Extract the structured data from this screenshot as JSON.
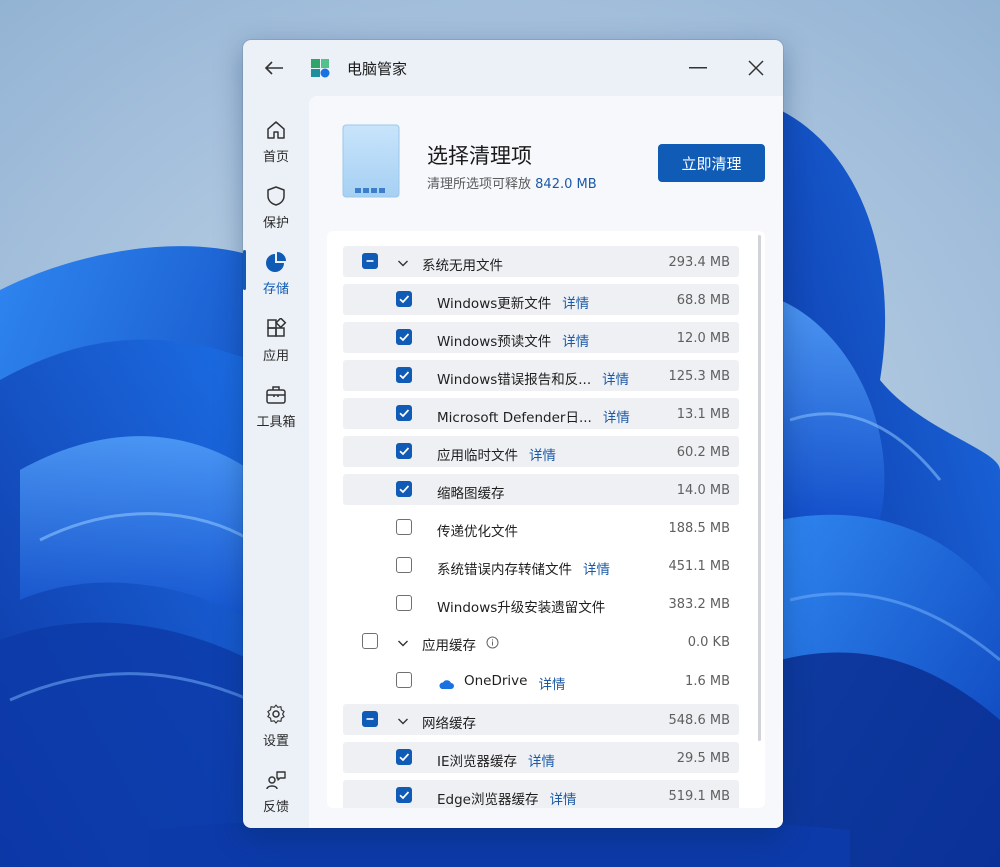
{
  "app": {
    "title": "电脑管家"
  },
  "sidebar": {
    "items": [
      {
        "label": "首页",
        "icon": "home-icon"
      },
      {
        "label": "保护",
        "icon": "shield-icon"
      },
      {
        "label": "存储",
        "icon": "pie-chart-icon",
        "active": true
      },
      {
        "label": "应用",
        "icon": "apps-icon"
      },
      {
        "label": "工具箱",
        "icon": "toolbox-icon"
      }
    ],
    "bottom": [
      {
        "label": "设置",
        "icon": "gear-icon"
      },
      {
        "label": "反馈",
        "icon": "feedback-icon"
      }
    ]
  },
  "header": {
    "title": "选择清理项",
    "subtitle_prefix": "清理所选项可释放",
    "amount": "842.0 MB",
    "clean_button": "立即清理"
  },
  "detail_label": "详情",
  "groups": [
    {
      "name": "系统无用文件",
      "size": "293.4 MB",
      "state": "partial",
      "items": [
        {
          "name": "Windows更新文件",
          "size": "68.8 MB",
          "checked": true,
          "detail": true
        },
        {
          "name": "Windows预读文件",
          "size": "12.0 MB",
          "checked": true,
          "detail": true
        },
        {
          "name": "Windows错误报告和反...",
          "size": "125.3 MB",
          "checked": true,
          "detail": true
        },
        {
          "name": "Microsoft Defender日...",
          "size": "13.1 MB",
          "checked": true,
          "detail": true
        },
        {
          "name": "应用临时文件",
          "size": "60.2 MB",
          "checked": true,
          "detail": true
        },
        {
          "name": "缩略图缓存",
          "size": "14.0 MB",
          "checked": true,
          "detail": false
        },
        {
          "name": "传递优化文件",
          "size": "188.5 MB",
          "checked": false,
          "detail": false
        },
        {
          "name": "系统错误内存转储文件",
          "size": "451.1 MB",
          "checked": false,
          "detail": true
        },
        {
          "name": "Windows升级安装遗留文件",
          "size": "383.2 MB",
          "checked": false,
          "detail": false
        }
      ]
    },
    {
      "name": "应用缓存",
      "size": "0.0 KB",
      "state": "unchecked",
      "info": true,
      "items": [
        {
          "name": "OneDrive",
          "size": "1.6 MB",
          "checked": false,
          "detail": true,
          "icon": "onedrive-icon"
        }
      ]
    },
    {
      "name": "网络缓存",
      "size": "548.6 MB",
      "state": "partial",
      "items": [
        {
          "name": "IE浏览器缓存",
          "size": "29.5 MB",
          "checked": true,
          "detail": true
        },
        {
          "name": "Edge浏览器缓存",
          "size": "519.1 MB",
          "checked": true,
          "detail": true
        }
      ]
    }
  ],
  "colors": {
    "accent": "#0f5bb5",
    "link": "#1c5aa6"
  }
}
